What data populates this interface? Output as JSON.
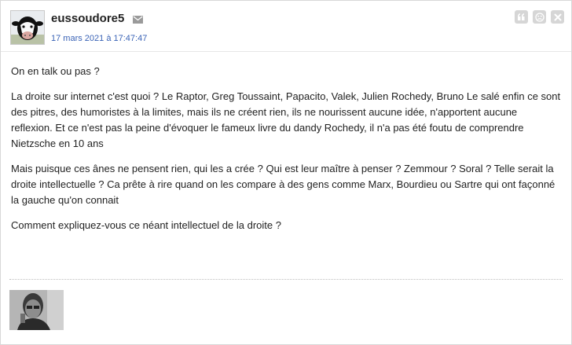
{
  "post": {
    "author": "eussoudore5",
    "date": "17 mars 2021 à 17:47:47",
    "icons": {
      "avatar": "cow-avatar-image",
      "message": "mail-icon",
      "quote": "quote-icon",
      "report": "sad-face-icon",
      "delete": "delete-icon",
      "signature": "signature-photo"
    },
    "paragraphs": [
      "On en talk ou pas ?",
      "La droite sur internet c'est quoi ? Le Raptor, Greg Toussaint, Papacito, Valek, Julien Rochedy, Bruno Le salé enfin ce sont des pitres, des humoristes à la limites, mais ils ne créent rien, ils ne nourissent aucune idée, n'apportent aucune reflexion. Et ce n'est pas la peine d'évoquer le fameux livre du dandy Rochedy, il n'a pas été foutu de comprendre Nietzsche en 10 ans",
      "Mais puisque ces ânes ne pensent rien, qui les a crée ? Qui est leur maître à penser ? Zemmour ? Soral ? Telle serait la droite intellectuelle ? Ca prête à rire quand on les compare à des gens comme Marx, Bourdieu ou Sartre qui ont façonné la gauche qu'on connait",
      "Comment expliquez-vous ce néant intellectuel de la droite ?"
    ]
  },
  "colors": {
    "date_link": "#3a63b6",
    "action_button_bg": "#d6d6d6",
    "border": "#d8d8d8"
  }
}
